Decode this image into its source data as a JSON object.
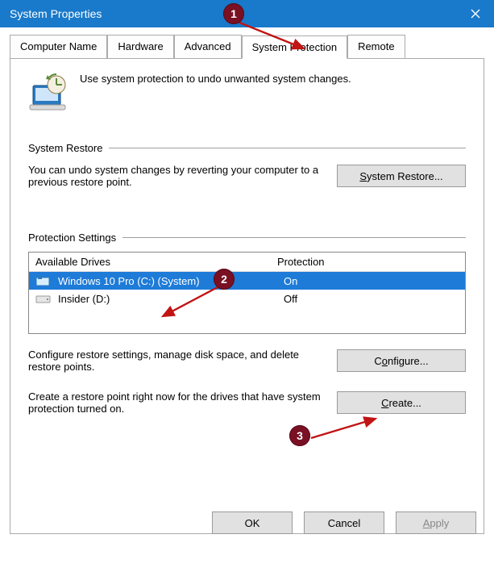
{
  "title": "System Properties",
  "tabs": {
    "t0": "Computer Name",
    "t1": "Hardware",
    "t2": "Advanced",
    "t3": "System Protection",
    "t4": "Remote"
  },
  "intro_text": "Use system protection to undo unwanted system changes.",
  "system_restore": {
    "group_title": "System Restore",
    "text": "You can undo system changes by reverting your computer to a previous restore point.",
    "button_before": "S",
    "button_after": "ystem Restore..."
  },
  "protection_settings": {
    "group_title": "Protection Settings",
    "col_drives": "Available Drives",
    "col_protection": "Protection",
    "rows": [
      {
        "name": "Windows 10 Pro (C:) (System)",
        "status": "On",
        "selected": true
      },
      {
        "name": "Insider (D:)",
        "status": "Off",
        "selected": false
      }
    ],
    "configure_text": "Configure restore settings, manage disk space, and delete restore points.",
    "configure_before": "C",
    "configure_after": "onfigure...",
    "create_text": "Create a restore point right now for the drives that have system protection turned on.",
    "create_before": "C",
    "create_after": "reate..."
  },
  "footer": {
    "ok": "OK",
    "cancel": "Cancel",
    "apply_before": "A",
    "apply_after": "pply"
  },
  "annotations": {
    "b1": "1",
    "b2": "2",
    "b3": "3"
  }
}
